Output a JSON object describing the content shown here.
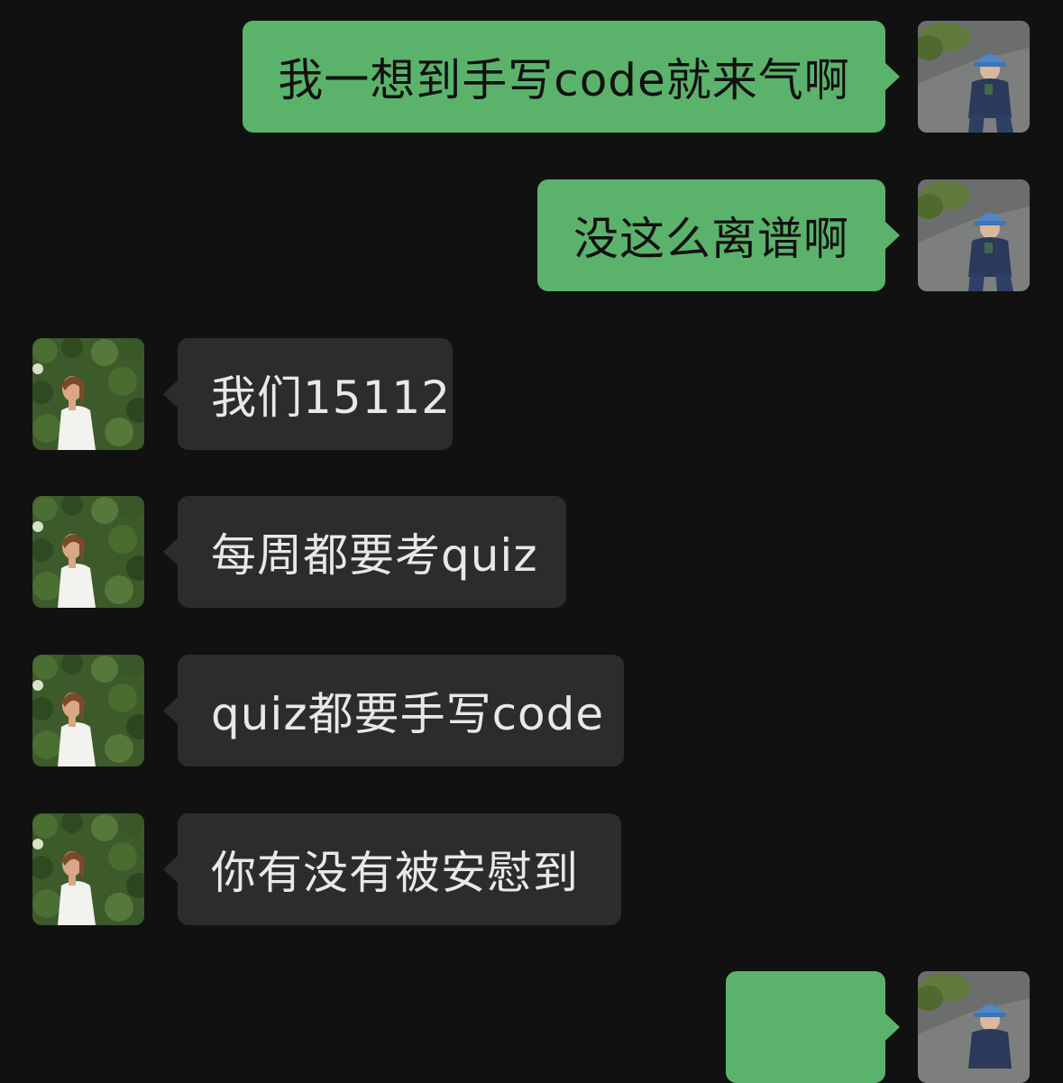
{
  "chat": {
    "messages": [
      {
        "side": "out",
        "text": "我一想到手写code就来气啊",
        "avatar": "self-avatar"
      },
      {
        "side": "out",
        "text": "没这么离谱啊",
        "avatar": "self-avatar"
      },
      {
        "side": "in",
        "text": "我们15112",
        "avatar": "contact-avatar"
      },
      {
        "side": "in",
        "text": "每周都要考quiz",
        "avatar": "contact-avatar"
      },
      {
        "side": "in",
        "text": "quiz都要手写code",
        "avatar": "contact-avatar"
      },
      {
        "side": "in",
        "text": "你有没有被安慰到",
        "avatar": "contact-avatar"
      },
      {
        "side": "out",
        "text": "",
        "avatar": "self-avatar"
      }
    ]
  },
  "colors": {
    "background": "#111111",
    "outgoing_bubble": "#5bb36b",
    "incoming_bubble": "#2c2c2c",
    "incoming_text": "#e8e8e8",
    "outgoing_text": "#111111"
  }
}
